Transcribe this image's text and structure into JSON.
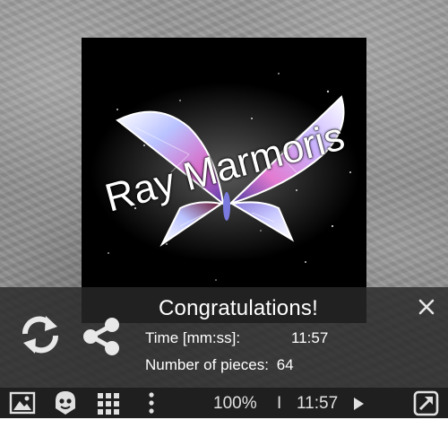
{
  "puzzle": {
    "watermark": "Ray Marmoris"
  },
  "result": {
    "title": "Congratulations!",
    "time_label": "Time [mm:ss]:",
    "time_value": "11:57",
    "pieces_label": "Number of pieces:",
    "pieces_value": "64"
  },
  "toolbar": {
    "zoom": "100%",
    "separator": "I",
    "timer": "11:57"
  },
  "icons": {
    "close": "close-icon",
    "restart": "restart-icon",
    "share": "share-icon",
    "image": "image-icon",
    "ghost": "ghost-icon",
    "grid": "grid-icon",
    "menu": "more-vertical-icon",
    "play": "play-icon",
    "fullscreen": "fullscreen-icon"
  },
  "colors": {
    "overlay": "#282828",
    "toolbar": "#1f1f1f",
    "text": "#ffffff"
  }
}
